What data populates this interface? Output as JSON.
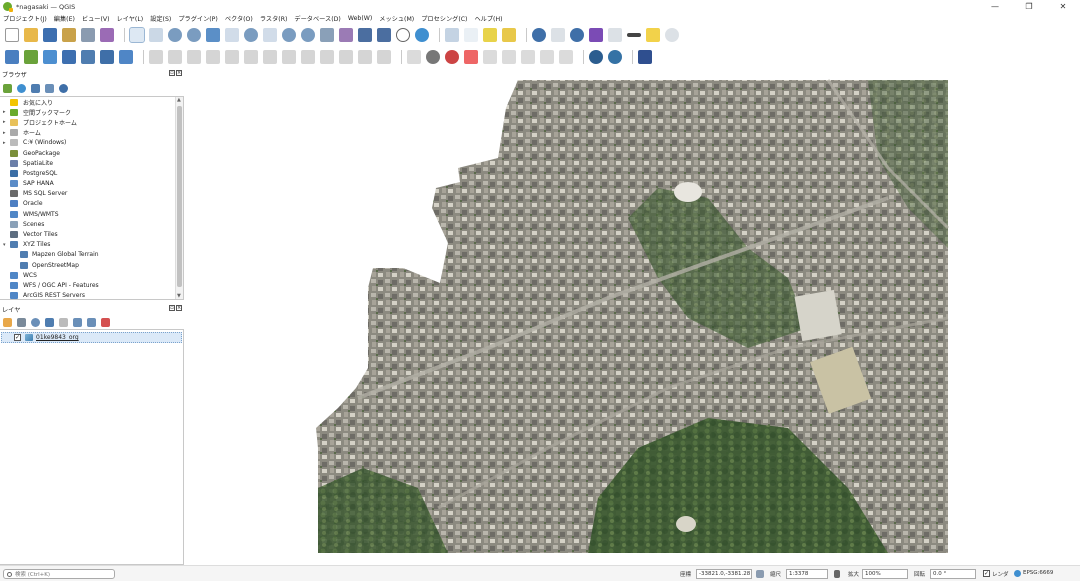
{
  "window": {
    "title": "*nagasaki — QGIS",
    "controls": {
      "minimize": "—",
      "maximize": "❐",
      "close": "✕"
    }
  },
  "menubar": [
    "プロジェクト(J)",
    "編集(E)",
    "ビュー(V)",
    "レイヤ(L)",
    "設定(S)",
    "プラグイン(P)",
    "ベクタ(O)",
    "ラスタ(R)",
    "データベース(D)",
    "Web(W)",
    "メッシュ(M)",
    "プロセシング(C)",
    "ヘルプ(H)"
  ],
  "colors": {
    "accent": "#3f7fb0",
    "layer_selected_bg": "#dbe9f8"
  },
  "browser_panel": {
    "title": "ブラウザ",
    "items": [
      {
        "label": "お気に入り",
        "icon": "star-icon",
        "color": "#f2c400",
        "expandable": false
      },
      {
        "label": "空間ブックマーク",
        "icon": "bookmark-icon",
        "color": "#6aab2c",
        "expandable": true
      },
      {
        "label": "プロジェクトホーム",
        "icon": "folder-icon",
        "color": "#e8c15a",
        "expandable": true
      },
      {
        "label": "ホーム",
        "icon": "home-folder-icon",
        "color": "#aaaaaa",
        "expandable": true
      },
      {
        "label": "C:¥ (Windows)",
        "icon": "drive-icon",
        "color": "#bbbbbb",
        "expandable": true
      },
      {
        "label": "GeoPackage",
        "icon": "geopackage-icon",
        "color": "#7b8f3a",
        "expandable": false
      },
      {
        "label": "SpatiaLite",
        "icon": "spatialite-icon",
        "color": "#6b7fa8",
        "expandable": false
      },
      {
        "label": "PostgreSQL",
        "icon": "postgresql-icon",
        "color": "#3b6ea5",
        "expandable": false
      },
      {
        "label": "SAP HANA",
        "icon": "sap-hana-icon",
        "color": "#5b8cc8",
        "expandable": false
      },
      {
        "label": "MS SQL Server",
        "icon": "mssql-icon",
        "color": "#6a6a6a",
        "expandable": false
      },
      {
        "label": "Oracle",
        "icon": "oracle-icon",
        "color": "#4d7fc2",
        "expandable": false
      },
      {
        "label": "WMS/WMTS",
        "icon": "wms-icon",
        "color": "#4f86c6",
        "expandable": false
      },
      {
        "label": "Scenes",
        "icon": "scenes-icon",
        "color": "#8aa1b8",
        "expandable": false
      },
      {
        "label": "Vector Tiles",
        "icon": "vector-tiles-icon",
        "color": "#5d6d80",
        "expandable": false
      },
      {
        "label": "XYZ Tiles",
        "icon": "xyz-tiles-icon",
        "color": "#4f7db0",
        "expandable": true,
        "expanded": true
      },
      {
        "label": "Mapzen Global Terrain",
        "icon": "xyz-tile-layer-icon",
        "color": "#4f7db0",
        "child": true
      },
      {
        "label": "OpenStreetMap",
        "icon": "xyz-tile-layer-icon",
        "color": "#4f7db0",
        "child": true
      },
      {
        "label": "WCS",
        "icon": "wcs-icon",
        "color": "#4f86c6",
        "expandable": false
      },
      {
        "label": "WFS / OGC API - Features",
        "icon": "wfs-icon",
        "color": "#4f86c6",
        "expandable": false
      },
      {
        "label": "ArcGIS REST Servers",
        "icon": "arcgis-icon",
        "color": "#4f86c6",
        "expandable": false
      }
    ]
  },
  "layers_panel": {
    "title": "レイヤ",
    "layers": [
      {
        "name": "01ke9843_org",
        "checked": true,
        "icon": "raster-layer-icon"
      }
    ]
  },
  "statusbar": {
    "search_placeholder": "検索 (Ctrl+K)",
    "coordinate_label": "座標",
    "coordinate_value": "-33821.0,-3381.28",
    "scale_label": "縮尺",
    "scale_value": "1:3378",
    "magnifier_label": "拡大",
    "magnifier_value": "100%",
    "rotation_label": "回転",
    "rotation_value": "0.0 °",
    "render_label": "レンダ",
    "render_checked": true,
    "crs": "EPSG:6669"
  }
}
